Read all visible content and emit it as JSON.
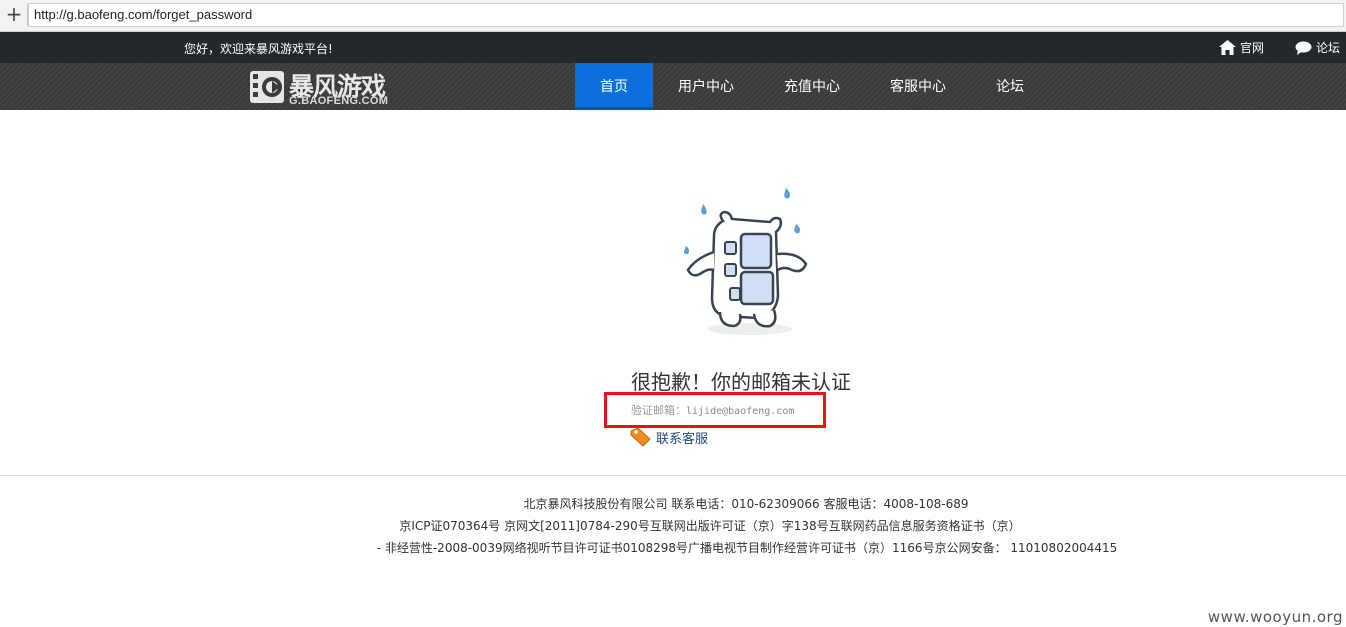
{
  "browser": {
    "new_tab_symbol": "+",
    "url": "http://g.baofeng.com/forget_password"
  },
  "topbar": {
    "welcome": "您好，欢迎来暴风游戏平台!",
    "links": [
      {
        "icon": "home-icon",
        "label": "官网"
      },
      {
        "icon": "speech-bubble-icon",
        "label": "论坛"
      }
    ]
  },
  "header": {
    "logo_title": "暴风游戏",
    "logo_subtitle": "G.BAOFENG.COM",
    "nav": [
      {
        "label": "首页",
        "active": true
      },
      {
        "label": "用户中心",
        "active": false
      },
      {
        "label": "充值中心",
        "active": false
      },
      {
        "label": "客服中心",
        "active": false
      },
      {
        "label": "论坛",
        "active": false
      }
    ]
  },
  "main": {
    "mascot_icon": "sweating-film-mascot-icon",
    "error_title": "很抱歉！你的邮箱未认证",
    "email_label": "验证邮箱：",
    "email_value": "lijide@baofeng.com",
    "contact_label": "联系客服",
    "highlight_color": "#e0161b"
  },
  "footer": {
    "line1": "北京暴风科技股份有限公司 联系电话：010-62309066 客服电话：4008-108-689",
    "line2": "京ICP证070364号  京网文[2011]0784-290号互联网出版许可证（京）字138号互联网药品信息服务资格证书（京）",
    "line3": "- 非经营性-2008-0039网络视听节目许可证书0108298号广播电视节目制作经营许可证书（京）1166号京公网安备： 11010802004415"
  },
  "watermark": "www.wooyun.org",
  "colors": {
    "nav_active": "#0c6fdc",
    "topbar_bg": "#25282b",
    "nav_bg": "#3a3a3a"
  }
}
